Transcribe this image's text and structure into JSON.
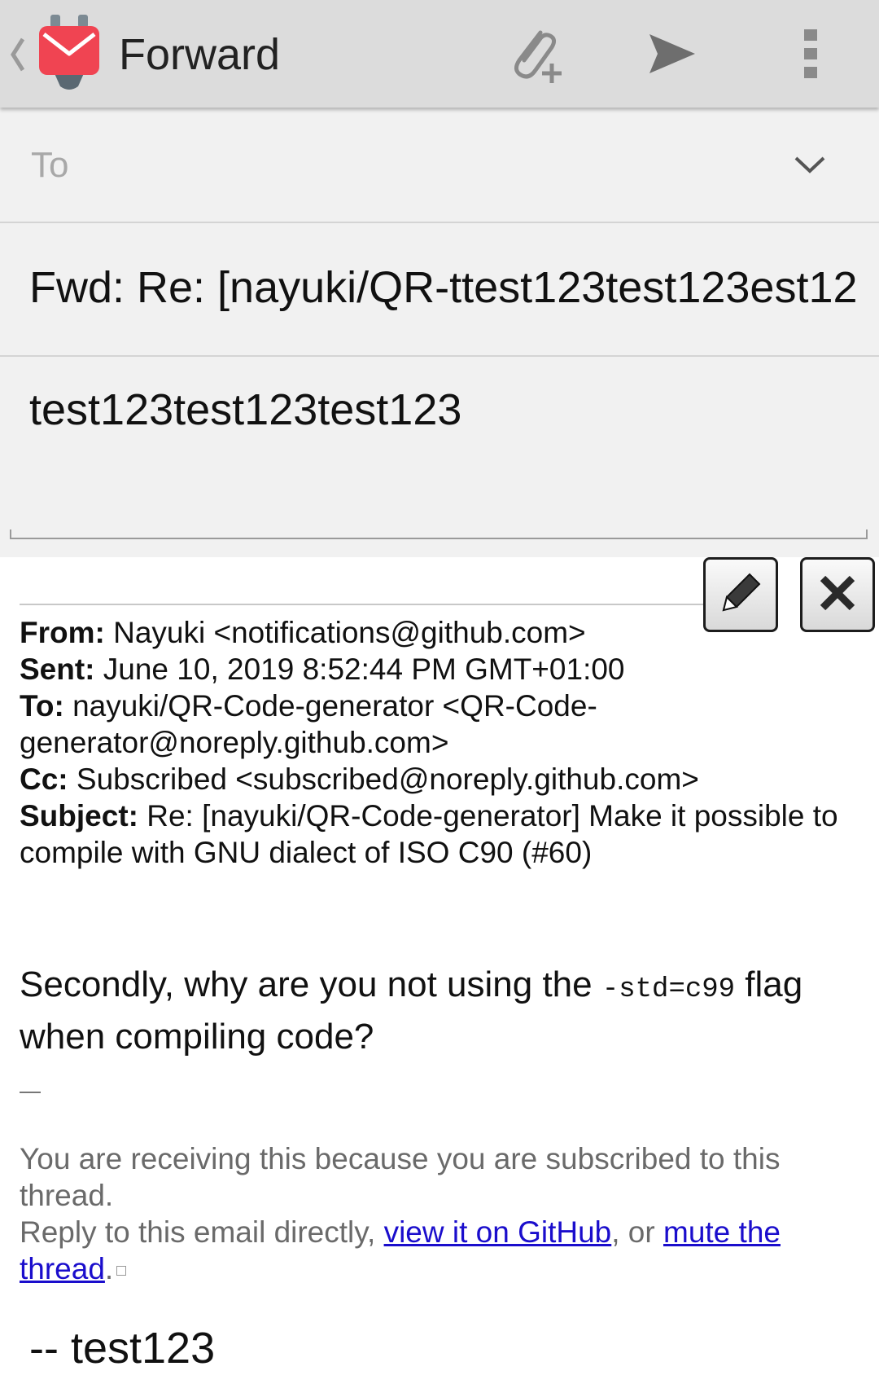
{
  "action_bar": {
    "title": "Forward",
    "icons": {
      "back": "chevron-left-icon",
      "logo": "k9-mail-logo",
      "attach": "paperclip-plus-icon",
      "send": "send-icon",
      "menu": "overflow-menu-icon"
    },
    "colors": {
      "bar": "#dcdcdc",
      "logo_red": "#f04452"
    }
  },
  "compose": {
    "to_placeholder": "To",
    "subject": "Fwd: Re: [nayuki/QR-ttest123test123est12",
    "body": "test123test123test123"
  },
  "quoted": {
    "from_label": "From:",
    "from_value": "Nayuki <notifications@github.com>",
    "sent_label": "Sent:",
    "sent_value": "June 10, 2019 8:52:44 PM GMT+01:00",
    "to_label": "To:",
    "to_value": "nayuki/QR-Code-generator <QR-Code-generator@noreply.github.com>",
    "cc_label": "Cc:",
    "cc_value": "Subscribed <subscribed@noreply.github.com>",
    "subject_label": "Subject:",
    "subject_value": "Re: [nayuki/QR-Code-generator] Make it possible to compile with GNU dialect of ISO C90 (#60)",
    "message_prefix": "Secondly, why are you not using the ",
    "message_code": "-std=c99",
    "message_suffix": " flag when compiling code?",
    "footer_line1": "You are receiving this because you are subscribed to this thread.",
    "footer_reply": "Reply to this email directly, ",
    "footer_link1": "view it on GitHub",
    "footer_or": ", or ",
    "footer_link2": "mute the thread",
    "footer_end": ".",
    "edit_icon": "pencil-icon",
    "delete_icon": "close-x-icon",
    "link_color": "#1a0dcc"
  },
  "signature": "-- test123"
}
